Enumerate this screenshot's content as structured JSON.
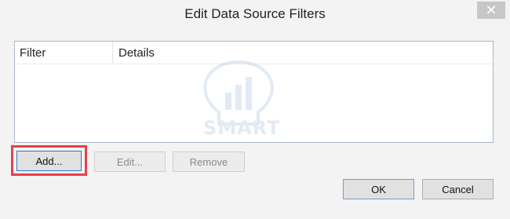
{
  "dialog": {
    "title": "Edit Data Source Filters",
    "close_glyph": "✕"
  },
  "list": {
    "columns": [
      "Filter",
      "Details"
    ],
    "rows": []
  },
  "watermark": {
    "text": "SMART BUSINESS",
    "icon": "lightbulb-chart-icon",
    "color": "#1a5aa8"
  },
  "buttons": {
    "add": "Add...",
    "edit": "Edit...",
    "remove": "Remove",
    "ok": "OK",
    "cancel": "Cancel"
  },
  "colors": {
    "highlight": "#e8404a",
    "close_button_bg": "#c7c7c7"
  }
}
